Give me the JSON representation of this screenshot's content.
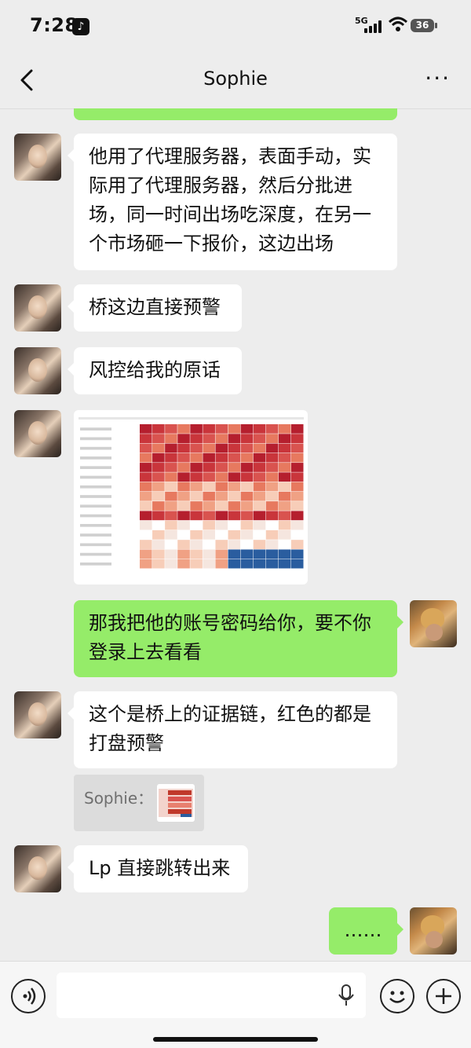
{
  "status": {
    "time": "7:28",
    "network": "5G",
    "battery": "36"
  },
  "header": {
    "title": "Sophie"
  },
  "messages": [
    {
      "from": "Sophie",
      "text": "他用了代理服务器，表面手动，实际用了代理服务器，然后分批进场，同一时间出场吃深度，在另一个市场砸一下报价，这边出场"
    },
    {
      "from": "Sophie",
      "text": "桥这边直接预警"
    },
    {
      "from": "Sophie",
      "text": "风控给我的原话"
    },
    {
      "from": "Sophie",
      "type": "image"
    },
    {
      "from": "me",
      "text": "那我把他的账号密码给你，要不你登录上去看看"
    },
    {
      "from": "Sophie",
      "text": "这个是桥上的证据链，红色的都是打盘预警"
    },
    {
      "from": "Sophie",
      "type": "quote",
      "text": "Sophie："
    },
    {
      "from": "Sophie",
      "text": "Lp 直接跳转出来"
    },
    {
      "from": "me",
      "text": "……"
    }
  ],
  "input": {
    "placeholder": ""
  },
  "icons": {
    "back": "chevron-left-icon",
    "more": "more-dots-icon",
    "voice": "voice-icon",
    "mic": "microphone-icon",
    "emoji": "emoji-icon",
    "plus": "plus-icon"
  },
  "colors": {
    "background": "#ededed",
    "my_bubble": "#95ec69",
    "their_bubble": "#ffffff"
  }
}
